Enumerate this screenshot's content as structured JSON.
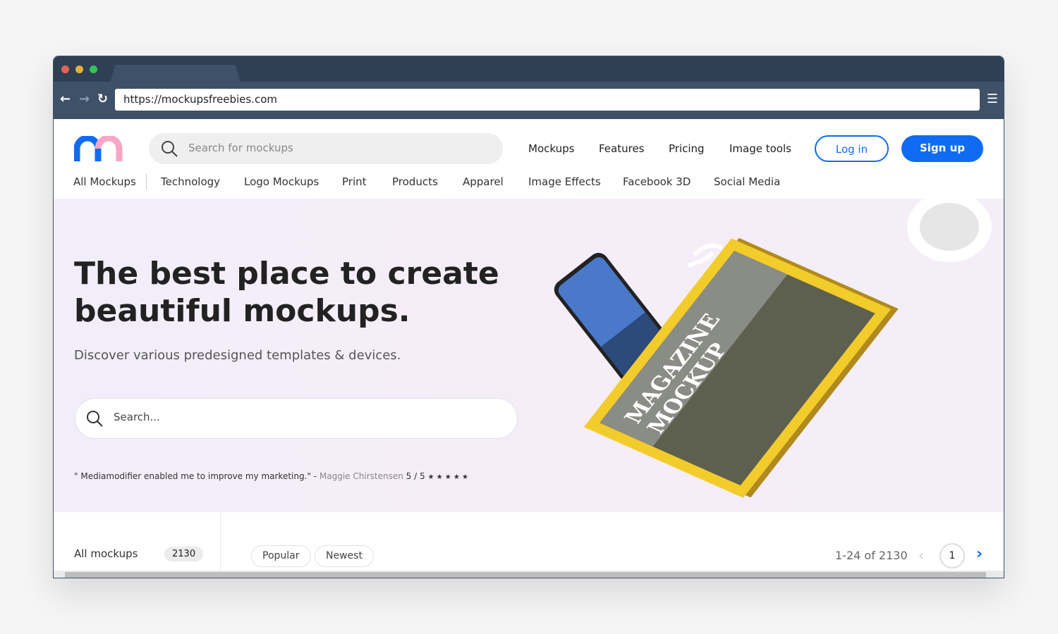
{
  "browser": {
    "url": "https://mockupsfreebies.com",
    "traffic_lights": [
      "#ec5f57",
      "#e0b33a",
      "#31c553"
    ]
  },
  "header": {
    "search_placeholder": "Search for mockups",
    "nav": [
      "Mockups",
      "Features",
      "Pricing",
      "Image tools"
    ],
    "login": "Log in",
    "signup": "Sign up",
    "accent": "#0f6cf2"
  },
  "categories": [
    "All Mockups",
    "Technology",
    "Logo Mockups",
    "Print",
    "Products",
    "Apparel",
    "Image Effects",
    "Facebook 3D",
    "Social Media"
  ],
  "hero": {
    "title_line1": "The best place to create",
    "title_line2": "beautiful mockups.",
    "subtitle": "Discover various predesigned templates & devices.",
    "search_placeholder": "Search...",
    "quote": "\" Mediamodifier enabled me to improve my marketing.\" - ",
    "quote_author": "Maggie Chirstensen",
    "rating": "5 / 5",
    "stars": "★ ★ ★ ★ ★",
    "image_text": "MAGAZINE MOCKUP"
  },
  "listing": {
    "all_label": "All mockups",
    "all_count": "2130",
    "sort": [
      "Popular",
      "Newest"
    ],
    "range": "1-24 of 2130",
    "page": "1"
  }
}
